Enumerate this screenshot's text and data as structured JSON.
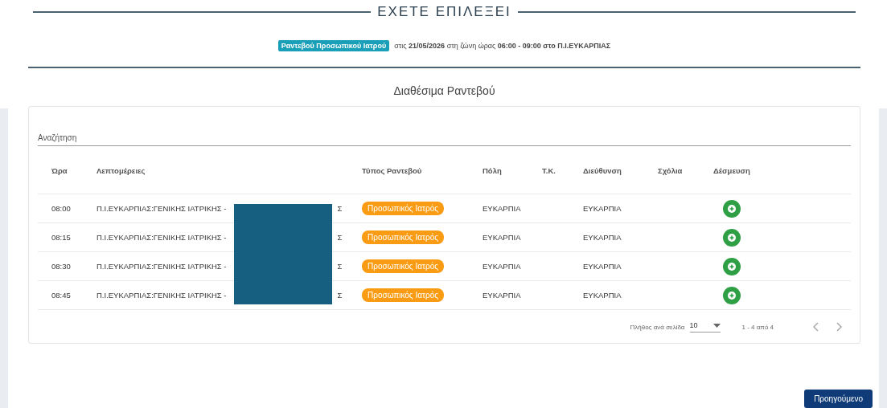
{
  "heading": "ΕΧΕΤΕ ΕΠΙΛΕΞΕΙ",
  "summary": {
    "badge": "Ραντεβού Προσωπικού Ιατρού",
    "text": "στις **21/05/2026** στη ζώνη ώρας **06:00 - 09:00 στο Π.Ι.ΕΥΚΑΡΠΙΑΣ**"
  },
  "section_title": "Διαθέσιμα Ραντεβού",
  "search": {
    "placeholder": "Αναζήτηση"
  },
  "table": {
    "columns": [
      "Ώρα",
      "Λεπτομέρειες",
      "Τύπος Ραντεβού",
      "Πόλη",
      "Τ.Κ.",
      "Διεύθυνση",
      "Σχόλια",
      "Δέσμευση"
    ],
    "rows": [
      {
        "time": "08:00",
        "details": "Π.Ι.ΕΥΚΑΡΠΙΑΣ:ΓΕΝΙΚΗΣ ΙΑΤΡΙΚΗΣ -",
        "details_end": "Σ",
        "type": "Προσωπικός Ιατρός",
        "city": "ΕΥΚΑΡΠΙΑ",
        "address": "ΕΥΚΑΡΠΙΑ"
      },
      {
        "time": "08:15",
        "details": "Π.Ι.ΕΥΚΑΡΠΙΑΣ:ΓΕΝΙΚΗΣ ΙΑΤΡΙΚΗΣ -",
        "details_end": "Σ",
        "type": "Προσωπικός Ιατρός",
        "city": "ΕΥΚΑΡΠΙΑ",
        "address": "ΕΥΚΑΡΠΙΑ"
      },
      {
        "time": "08:30",
        "details": "Π.Ι.ΕΥΚΑΡΠΙΑΣ:ΓΕΝΙΚΗΣ ΙΑΤΡΙΚΗΣ -",
        "details_end": "Σ",
        "type": "Προσωπικός Ιατρός",
        "city": "ΕΥΚΑΡΠΙΑ",
        "address": "ΕΥΚΑΡΠΙΑ"
      },
      {
        "time": "08:45",
        "details": "Π.Ι.ΕΥΚΑΡΠΙΑΣ:ΓΕΝΙΚΗΣ ΙΑΤΡΙΚΗΣ -",
        "details_end": "Σ",
        "type": "Προσωπικός Ιατρός",
        "city": "ΕΥΚΑΡΠΙΑ",
        "address": "ΕΥΚΑΡΠΙΑ"
      }
    ]
  },
  "pagination": {
    "label": "Πλήθος ανά σελίδα",
    "page_size": "10",
    "range": "1 - 4 από 4"
  },
  "buttons": [
    "Προηγούμενο"
  ]
}
